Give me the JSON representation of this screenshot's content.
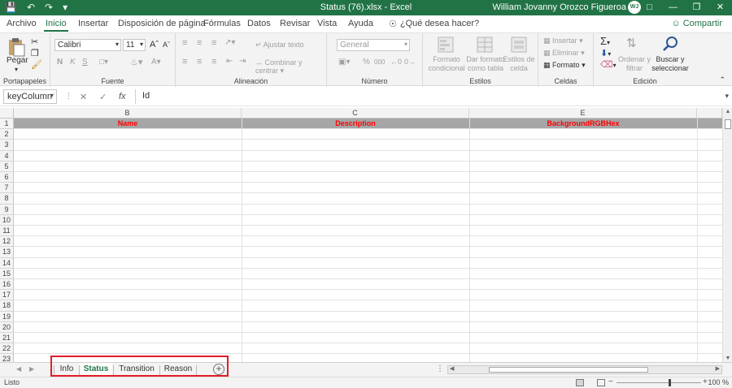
{
  "titlebar": {
    "filename": "Status (76).xlsx",
    "separator": "-",
    "app": "Excel",
    "user": "William Jovanny Orozco Figueroa",
    "initials": "WJ"
  },
  "tabs": [
    "Archivo",
    "Inicio",
    "Insertar",
    "Disposición de página",
    "Fórmulas",
    "Datos",
    "Revisar",
    "Vista",
    "Ayuda"
  ],
  "active_tab": "Inicio",
  "tell_me": "¿Qué desea hacer?",
  "share": "Compartir",
  "ribbon": {
    "clipboard": {
      "paste": "Pegar",
      "label": "Portapapeles"
    },
    "font": {
      "name": "Calibri",
      "size": "11",
      "bold": "N",
      "italic": "K",
      "underline": "S",
      "label": "Fuente"
    },
    "alignment": {
      "wrap": "Ajustar texto",
      "merge": "Combinar y centrar",
      "label": "Alineación"
    },
    "number": {
      "format": "General",
      "percent": "%",
      "comma": "000",
      "label": "Número"
    },
    "styles": {
      "conditional": "Formato condicional",
      "table": "Dar formato como tabla",
      "cell": "Estilos de celda",
      "label": "Estilos"
    },
    "cells": {
      "insert": "Insertar",
      "delete": "Eliminar",
      "format": "Formato",
      "label": "Celdas"
    },
    "editing": {
      "sort": "Ordenar y filtrar",
      "find": "Buscar y seleccionar",
      "label": "Edición"
    }
  },
  "formula_bar": {
    "name_box": "keyColumn",
    "fx": "fx",
    "value": "Id"
  },
  "grid": {
    "columns": [
      "B",
      "C",
      "E"
    ],
    "header_cells": [
      "Name",
      "Description",
      "BackgroundRGBHex"
    ],
    "rows": [
      "1",
      "2",
      "3",
      "4",
      "5",
      "6",
      "7",
      "8",
      "9",
      "10",
      "11",
      "12",
      "13",
      "14",
      "15",
      "16",
      "17",
      "18",
      "19",
      "20",
      "21",
      "22",
      "23"
    ]
  },
  "sheets": [
    "Info",
    "Status",
    "Transition",
    "Reason"
  ],
  "active_sheet": "Status",
  "status": {
    "ready": "Listo",
    "zoom": "100 %"
  },
  "colors": {
    "excel_green": "#217346",
    "header_fill": "#a6a6a6",
    "header_text": "#ff0000",
    "highlight": "#e11d2a"
  }
}
